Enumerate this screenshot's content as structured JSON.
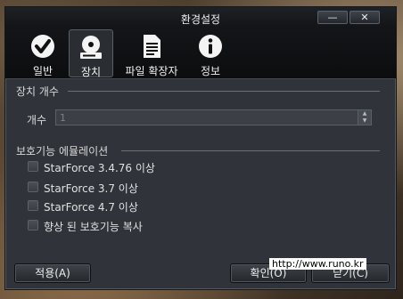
{
  "window": {
    "title": "환경설정",
    "minimize_glyph": "—",
    "close_glyph": "✕"
  },
  "toolbar": {
    "tabs": [
      {
        "label": "일반",
        "icon": "check-circle-icon"
      },
      {
        "label": "장치",
        "icon": "disc-drive-icon",
        "active": true
      },
      {
        "label": "파일 확장자",
        "icon": "document-icon"
      },
      {
        "label": "정보",
        "icon": "info-icon"
      }
    ]
  },
  "device_count": {
    "section_title": "장치 개수",
    "label": "개수",
    "value": "1"
  },
  "protection": {
    "section_title": "보호기능 에뮬레이션",
    "options": [
      {
        "label": "StarForce 3.4.76 이상",
        "checked": false
      },
      {
        "label": "StarForce 3.7 이상",
        "checked": false
      },
      {
        "label": "StarForce 4.7 이상",
        "checked": false
      },
      {
        "label": "향상 된 보호기능 복사",
        "checked": false
      }
    ]
  },
  "buttons": {
    "apply": "적용(A)",
    "ok": "확인(O)",
    "close": "닫기(C)"
  },
  "watermark": "http://www.runo.kr"
}
